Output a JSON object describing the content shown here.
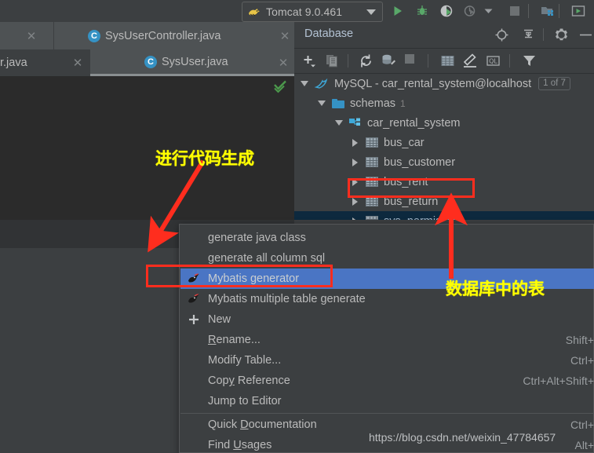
{
  "toolbar": {
    "run_config": {
      "label": "Tomcat 9.0.461",
      "icon": "tomcat-cat-icon",
      "caret": "chevron-down-icon"
    },
    "icons": [
      {
        "name": "run-icon",
        "title": "Run"
      },
      {
        "name": "debug-icon",
        "title": "Debug"
      },
      {
        "name": "run-coverage-icon",
        "title": "Run with Coverage"
      },
      {
        "name": "profile-icon",
        "title": "Profile"
      },
      {
        "name": "stop-icon",
        "title": "Stop"
      },
      {
        "name": "project-structure-icon",
        "title": "Project Structure"
      },
      {
        "name": "update-app-icon",
        "title": "Update Application"
      }
    ],
    "back_arrow_icon": "green-back-arrow-icon"
  },
  "editor_tabs": {
    "row1": [
      {
        "label": "",
        "close": "×",
        "has_icon": false
      },
      {
        "label": "SysUserController.java",
        "close": "×",
        "icon": "java-class-icon",
        "icon_letter": "C"
      }
    ],
    "row2": [
      {
        "label": "r.java",
        "close": "×",
        "has_icon": false
      },
      {
        "label": "SysUser.java",
        "close": "×",
        "icon": "java-class-icon",
        "icon_letter": "C",
        "active": true
      }
    ]
  },
  "editor": {
    "inspection_status_icon": "green-double-check-icon"
  },
  "database_panel": {
    "title": "Database",
    "header_icons": [
      {
        "name": "locate-target-icon"
      },
      {
        "name": "collapse-all-icon"
      },
      {
        "name": "settings-gear-icon"
      },
      {
        "name": "minimize-icon"
      }
    ],
    "toolbar_icons": [
      {
        "name": "add-data-source-icon"
      },
      {
        "name": "copy-icon"
      },
      {
        "name": "refresh-icon"
      },
      {
        "name": "db-tools-icon"
      },
      {
        "name": "stop-icon"
      },
      {
        "name": "table-editor-icon"
      },
      {
        "name": "modify-icon"
      },
      {
        "name": "query-console-icon"
      },
      {
        "name": "filter-icon"
      }
    ],
    "tree": [
      {
        "label": "MySQL - car_rental_system@localhost",
        "icon": "mysql-dolphin-icon",
        "caret": "down",
        "indent": 0,
        "badge": "1 of 7"
      },
      {
        "label": "schemas",
        "icon": "folder-icon",
        "caret": "down",
        "indent": 1,
        "sub": "1"
      },
      {
        "label": "car_rental_system",
        "icon": "schema-icon",
        "caret": "down",
        "indent": 2
      },
      {
        "label": "bus_car",
        "icon": "table-icon",
        "caret": "right",
        "indent": 3
      },
      {
        "label": "bus_customer",
        "icon": "table-icon",
        "caret": "right",
        "indent": 3
      },
      {
        "label": "bus_rent",
        "icon": "table-icon",
        "caret": "right",
        "indent": 3,
        "boxed": true
      },
      {
        "label": "bus_return",
        "icon": "table-icon",
        "caret": "right",
        "indent": 3
      },
      {
        "label": "sys_permission",
        "icon": "table-icon",
        "caret": "right",
        "indent": 3,
        "selected": true
      }
    ]
  },
  "context_menu": {
    "items": [
      {
        "label": "generate java class",
        "accel": "",
        "icon": ""
      },
      {
        "label": "generate all column sql",
        "accel": "",
        "icon": ""
      },
      {
        "label": "Mybatis generator",
        "accel": "",
        "icon": "mybatis-bird-icon",
        "highlight": true,
        "boxed": true
      },
      {
        "label": "Mybatis multiple table generate",
        "accel": "",
        "icon": "mybatis-bird-icon"
      },
      {
        "label": "New",
        "accel": "",
        "icon": "plus-icon"
      },
      {
        "label": "Rename...",
        "accel": "Shift+",
        "icon": "",
        "mnemonic": "R"
      },
      {
        "label": "Modify Table...",
        "accel": "Ctrl+",
        "icon": ""
      },
      {
        "label": "Copy Reference",
        "accel": "Ctrl+Alt+Shift+",
        "icon": "",
        "mnemonic": "y"
      },
      {
        "label": "Jump to Editor",
        "accel": "",
        "icon": ""
      },
      {
        "label": "Quick Documentation",
        "accel": "Ctrl+",
        "icon": "",
        "mnemonic": "D"
      },
      {
        "label": "Find Usages",
        "accel": "Alt+",
        "icon": "",
        "mnemonic": "U"
      }
    ]
  },
  "annotations": {
    "left_note": "进行代码生成",
    "right_note": "数据库中的表",
    "accent_red": "#ff2d1e",
    "accent_yellow": "#ffff00"
  },
  "watermark": {
    "text": "https://blog.csdn.net/weixin_47784657"
  }
}
